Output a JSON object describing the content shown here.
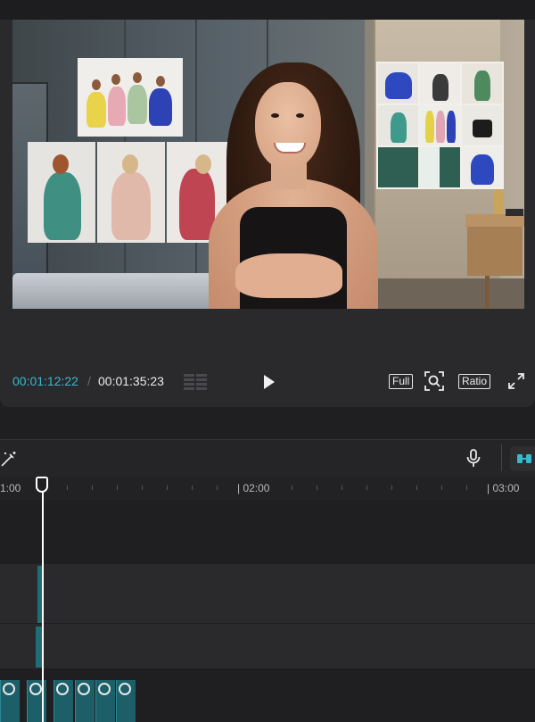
{
  "player": {
    "current_time": "00:01:12:22",
    "separator": "/",
    "total_time": "00:01:35:23",
    "full_label": "Full",
    "ratio_label": "Ratio"
  },
  "timeline": {
    "ruler_labels": [
      "1:00",
      "| 02:00",
      "| 03:00"
    ]
  },
  "icons": {
    "grid": "grid-icon",
    "play": "play-icon",
    "zoom": "zoom-fit-icon",
    "fullscreen": "fullscreen-icon",
    "magic": "magic-wand-icon",
    "mic": "microphone-icon",
    "connect": "connect-icon",
    "thumb": "speed-icon"
  },
  "colors": {
    "accent": "#38b9d0",
    "clip": "#1f6d77"
  }
}
